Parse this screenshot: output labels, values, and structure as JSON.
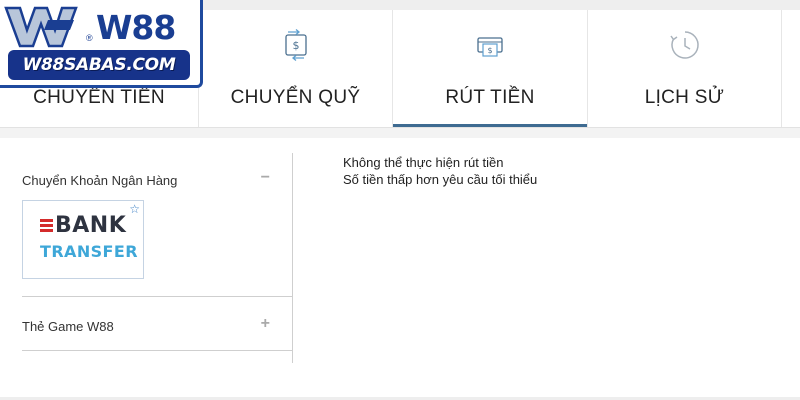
{
  "logo": {
    "brand": "W88",
    "registered": "®",
    "site": "W88SABAS.COM"
  },
  "tabs": [
    {
      "label": "CHUYỂN TIỀN",
      "icon": "transfer-icon",
      "active": false
    },
    {
      "label": "CHUYỂN QUỸ",
      "icon": "fund-transfer-icon",
      "active": false
    },
    {
      "label": "RÚT TIỀN",
      "icon": "withdraw-icon",
      "active": true
    },
    {
      "label": "LỊCH SỬ",
      "icon": "history-clock-icon",
      "active": false
    }
  ],
  "sidebar": {
    "bank_section": {
      "title": "Chuyển Khoản Ngân Hàng",
      "toggle": "−"
    },
    "bank_card": {
      "line1": "BANK",
      "line2": "TRANSFER",
      "star": "☆"
    },
    "game_section": {
      "title": "Thẻ Game W88",
      "toggle": "+"
    }
  },
  "message": {
    "line1": "Không thể thực hiện rút tiền",
    "line2": "Số tiền thấp hơn yêu cầu tối thiểu"
  },
  "colors": {
    "accent": "#3e6b91",
    "brand_blue": "#1a3e92",
    "bank_red": "#d42b2b",
    "transfer_blue": "#3ea7d8"
  }
}
